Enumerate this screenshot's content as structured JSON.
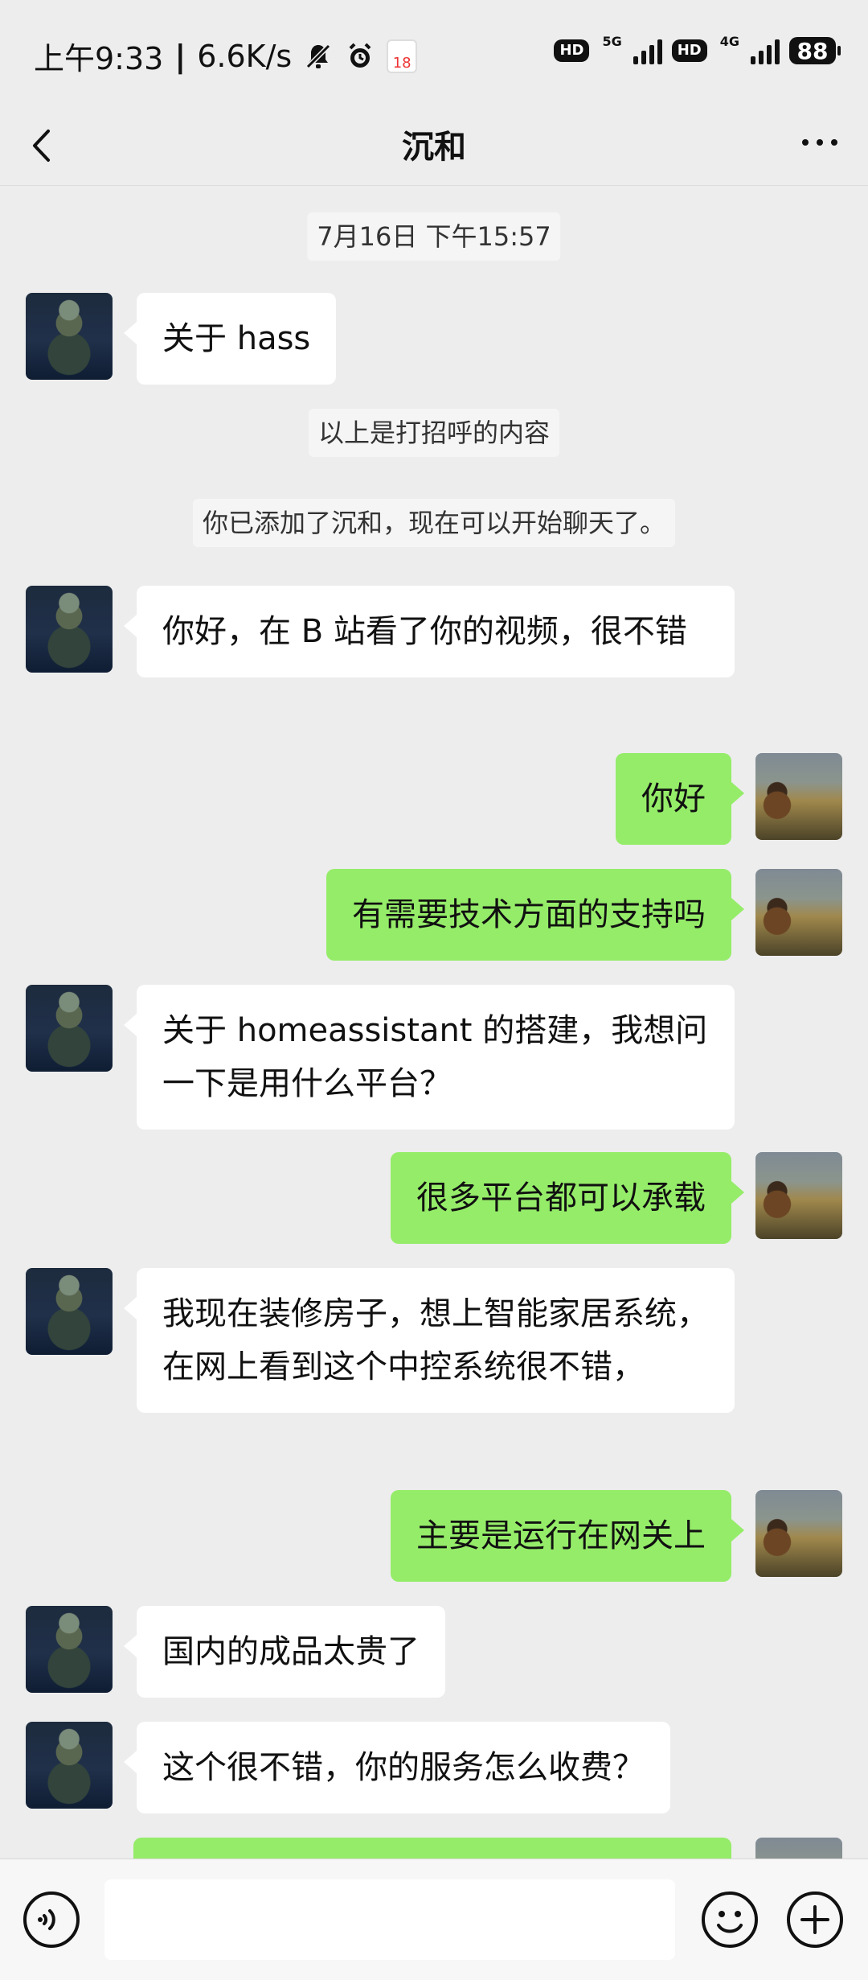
{
  "status_bar": {
    "time": "上午9:33",
    "separator": "|",
    "net_speed": "6.6K/s",
    "hd1": "HD",
    "net1": "5G",
    "hd2": "HD",
    "net2": "4G",
    "battery": "88",
    "calendar_day": "18"
  },
  "header": {
    "title": "沉和"
  },
  "chat": {
    "timestamp": "7月16日 下午15:57",
    "messages": [
      {
        "side": "left",
        "text": "关于 hass"
      },
      {
        "type": "system",
        "text": "以上是打招呼的内容"
      },
      {
        "type": "system",
        "text": "你已添加了沉和，现在可以开始聊天了。"
      },
      {
        "side": "left",
        "text": "你好，在 B 站看了你的视频，很不错"
      },
      {
        "side": "right",
        "text": "你好"
      },
      {
        "side": "right",
        "text": "有需要技术方面的支持吗"
      },
      {
        "side": "left",
        "text": "关于 homeassistant 的搭建，我想问一下是用什么平台？"
      },
      {
        "side": "right",
        "text": "很多平台都可以承载"
      },
      {
        "side": "left",
        "text": "我现在装修房子，想上智能家居系统，在网上看到这个中控系统很不错，"
      },
      {
        "side": "right",
        "text": "主要是运行在网关上"
      },
      {
        "side": "left",
        "text": "国内的成品太贵了"
      },
      {
        "side": "left",
        "text": "这个很不错，你的服务怎么收费？"
      }
    ]
  },
  "input_bar": {
    "value": ""
  },
  "icons": {
    "back": "chevron-left-icon",
    "more": "more-icon",
    "voice": "voice-icon",
    "emoji": "emoji-icon",
    "plus": "plus-icon"
  }
}
